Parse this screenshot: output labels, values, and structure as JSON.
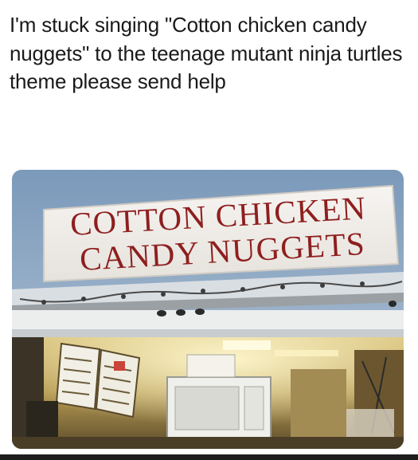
{
  "post": {
    "caption": "I'm stuck singing \"Cotton chicken candy nuggets\" to the teenage mutant ninja turtles theme please send help"
  },
  "photo": {
    "sign": {
      "line1": "COTTON CHICKEN",
      "line2": "CANDY NUGGETS",
      "text_color": "#8e1f1f",
      "board_color": "#f3f0ec"
    },
    "sky_color": "#8aa6c4"
  }
}
